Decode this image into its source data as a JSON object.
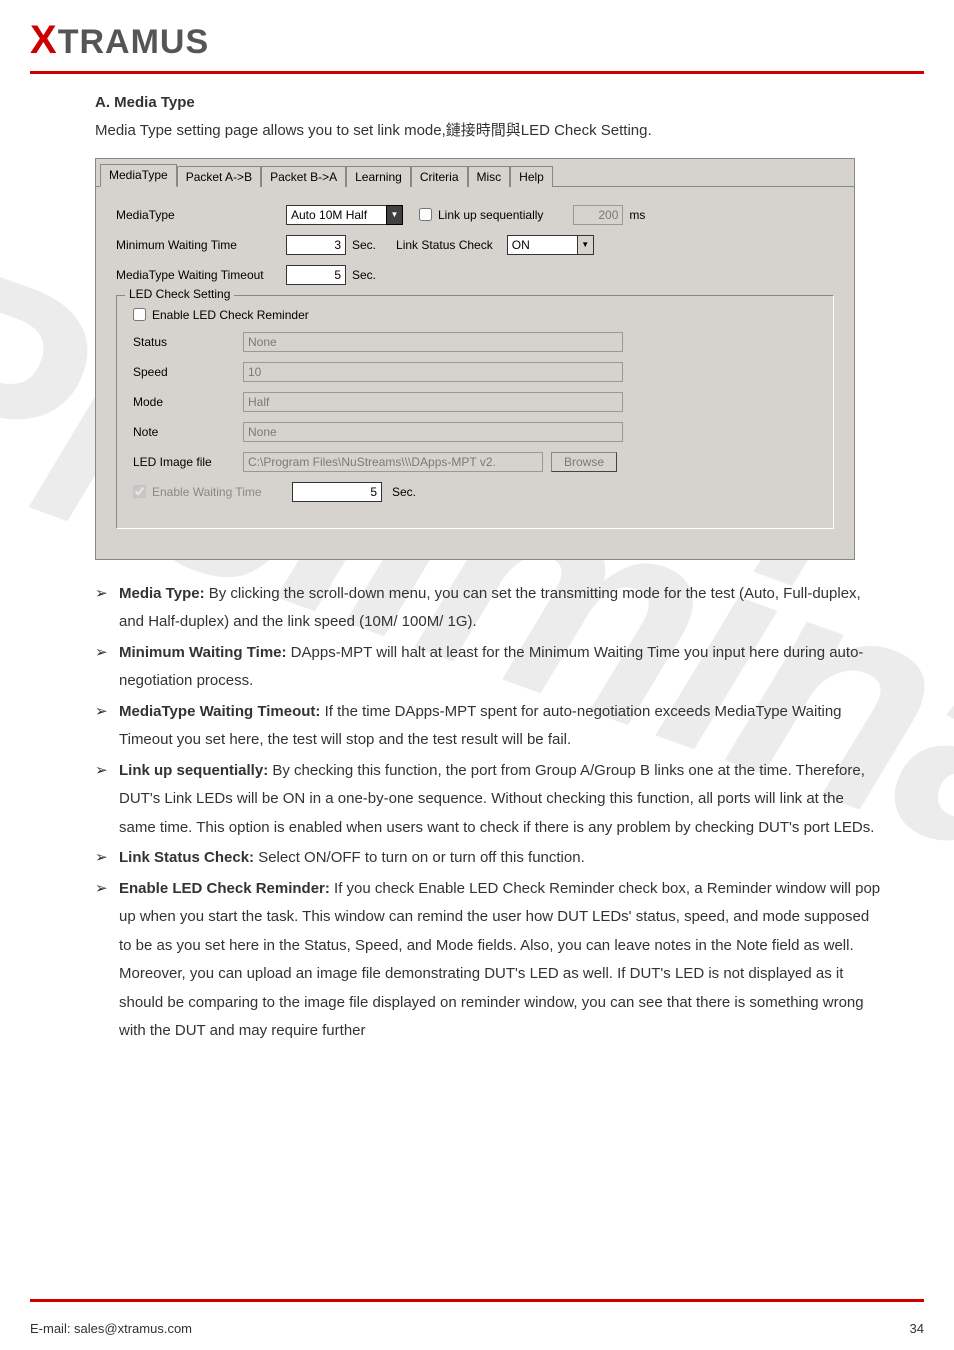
{
  "logo": {
    "x": "X",
    "rest": "TRAMUS"
  },
  "section": {
    "title": "A. Media Type",
    "intro": "Media Type setting page allows you to set link mode,鏈接時間與LED Check Setting."
  },
  "tabs": [
    "MediaType",
    "Packet A->B",
    "Packet B->A",
    "Learning",
    "Criteria",
    "Misc",
    "Help"
  ],
  "panel": {
    "row1": {
      "label": "MediaType",
      "value": "Auto 10M Half",
      "chk": "Link up sequentially",
      "ms_value": "200",
      "ms_unit": "ms"
    },
    "row2": {
      "label": "Minimum Waiting Time",
      "value": "3",
      "sec": "Sec.",
      "lsc": "Link Status Check",
      "lsc_val": "ON"
    },
    "row3": {
      "label": "MediaType Waiting Timeout",
      "value": "5",
      "sec": "Sec."
    },
    "fs": {
      "legend": "LED Check Setting",
      "enable": "Enable LED Check Reminder",
      "status_l": "Status",
      "status_v": "None",
      "speed_l": "Speed",
      "speed_v": "10",
      "mode_l": "Mode",
      "mode_v": "Half",
      "note_l": "Note",
      "note_v": "None",
      "img_l": "LED Image file",
      "img_v": "C:\\Program Files\\NuStreams\\\\\\DApps-MPT v2.",
      "browse": "Browse",
      "ewt": "Enable Waiting Time",
      "ewt_v": "5",
      "ewt_s": "Sec."
    }
  },
  "bullets": [
    {
      "b": "Media Type:",
      "t": " By clicking the scroll-down menu, you can set the transmitting mode for the test (Auto, Full-duplex, and Half-duplex) and the link speed (10M/ 100M/ 1G)."
    },
    {
      "b": "Minimum Waiting Time:",
      "t": " DApps-MPT will halt at least for the Minimum Waiting Time you input here during auto-negotiation process."
    },
    {
      "b": "MediaType Waiting Timeout:",
      "t": " If the time DApps-MPT spent for auto-negotiation exceeds MediaType Waiting Timeout you set here, the test will stop and the test result will be fail."
    },
    {
      "b": "Link up sequentially:",
      "t": " By checking this function, the port from Group A/Group B links one at the time. Therefore, DUT's Link LEDs will be ON in a one-by-one sequence. Without checking this function, all ports will link at the same time. This option is enabled when users want to check if there is any problem by checking DUT's port LEDs."
    },
    {
      "b": "Link Status Check:",
      "t": " Select ON/OFF to turn on or turn off this function."
    },
    {
      "b": "Enable LED Check Reminder:",
      "t": " If you check Enable LED Check Reminder check box, a Reminder window will pop up when you start the task. This window can remind the user how DUT LEDs' status, speed, and mode supposed to be as you set here in the Status, Speed, and Mode fields. Also, you can leave notes in the Note field as well. Moreover, you can upload an image file demonstrating DUT's LED as well. If DUT's LED is not displayed as it should be comparing to the image file displayed on reminder window, you can see that there is something wrong with the DUT and may require further"
    }
  ],
  "footer": {
    "left": "E-mail: sales@xtramus.com",
    "right": "34"
  }
}
